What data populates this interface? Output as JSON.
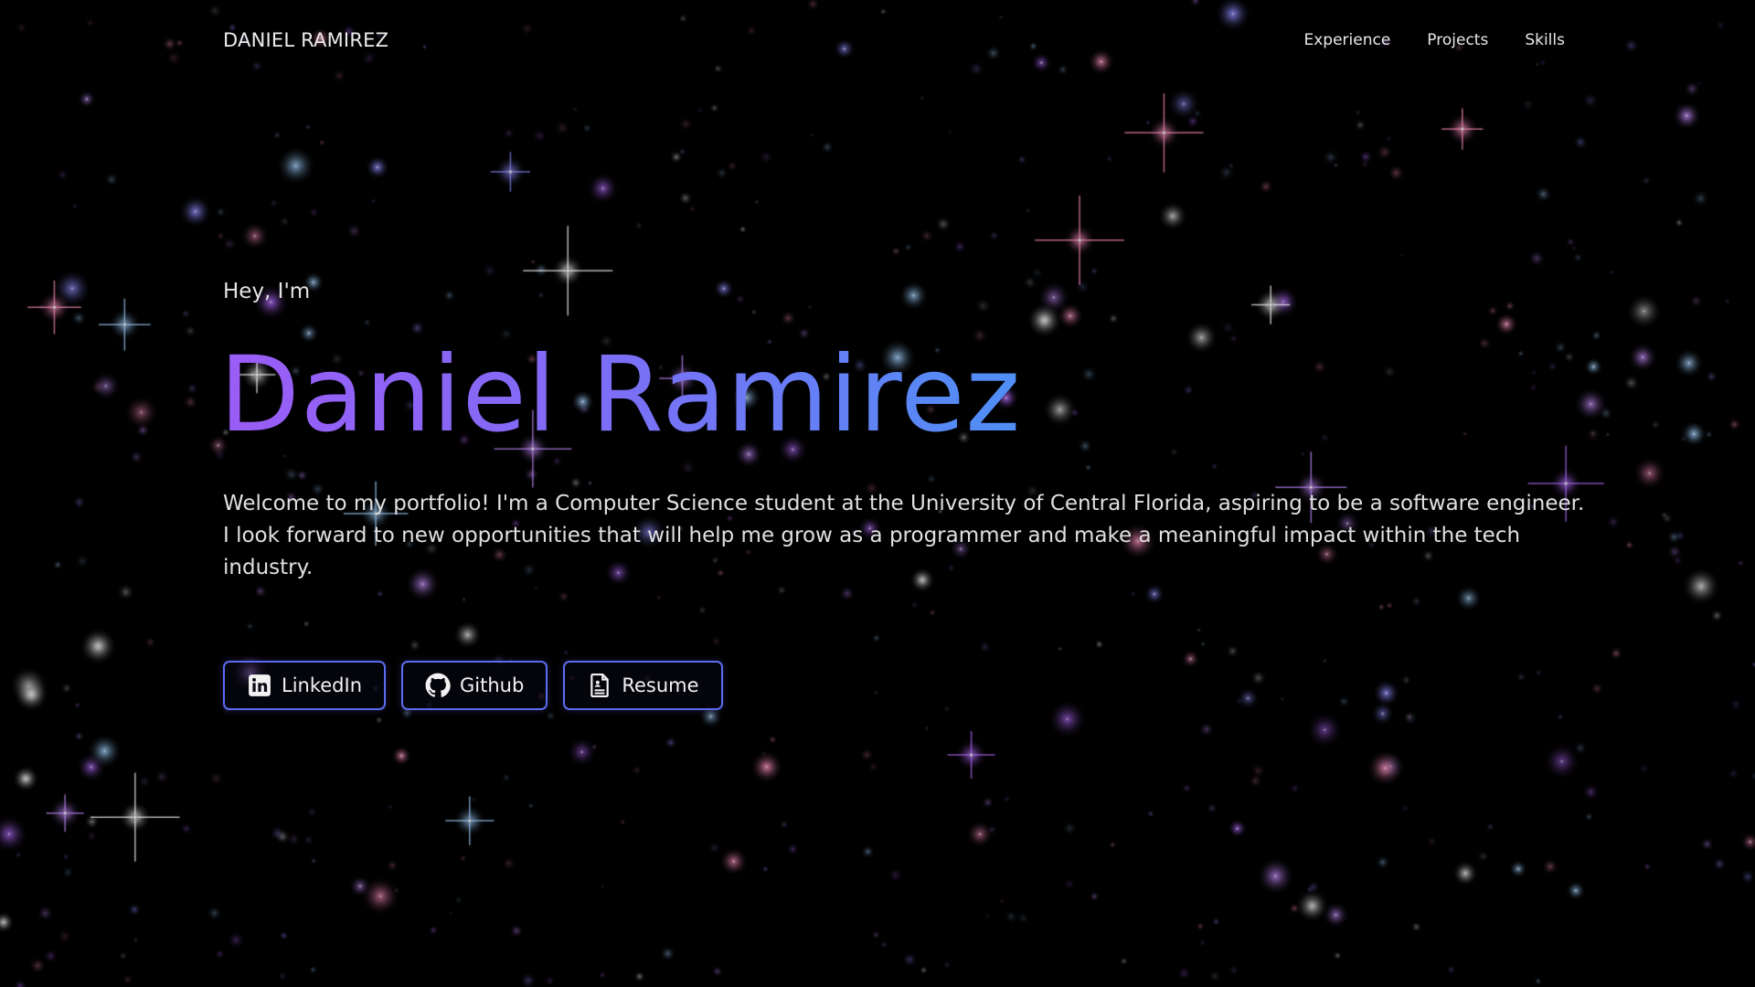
{
  "nav": {
    "brand": "DANIEL RAMIREZ",
    "links": [
      {
        "label": "Experience"
      },
      {
        "label": "Projects"
      },
      {
        "label": "Skills"
      }
    ]
  },
  "hero": {
    "greeting": "Hey, I'm",
    "name": "Daniel Ramirez",
    "intro": "Welcome to my portfolio! I'm a Computer Science student at the University of Central Florida, aspiring to be a software engineer. I look forward to new opportunities that will help me grow as a programmer and make a meaningful impact within the tech industry."
  },
  "buttons": [
    {
      "label": "LinkedIn",
      "icon": "linkedin-icon"
    },
    {
      "label": "Github",
      "icon": "github-icon"
    },
    {
      "label": "Resume",
      "icon": "document-icon"
    }
  ],
  "colors": {
    "background": "#000000",
    "gradient_start": "#9b5cf6",
    "gradient_end": "#4f8ff5",
    "button_border": "#5b6cf0",
    "star_colors": [
      "#c58cff",
      "#8f8cff",
      "#ff8fbf",
      "#9fd0ff",
      "#ffffff",
      "#b46bff"
    ]
  }
}
